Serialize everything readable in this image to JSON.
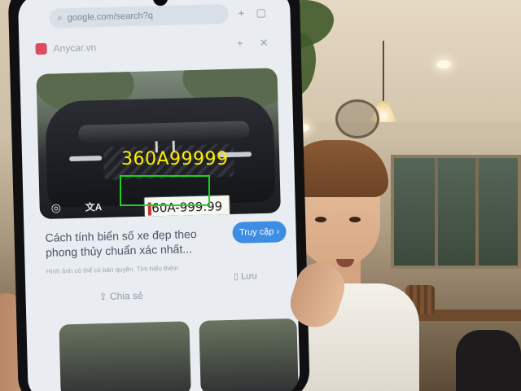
{
  "detection": {
    "label": "360A99999",
    "label_color": "#ffee00",
    "box_color": "#1fd11f"
  },
  "browser": {
    "url": "google.com/search?q",
    "tab_title": "Anycar.vn",
    "icons": [
      "home-icon",
      "plus-icon",
      "tab-switcher-icon",
      "menu-icon"
    ]
  },
  "result": {
    "plate": "60A-999.99",
    "title": "Cách tính biển số xe đẹp theo phong thủy chuẩn xác nhất...",
    "meta": "Hình ảnh có thể có bản quyền. Tìm hiểu thêm",
    "visit_label": "Truy cập",
    "share_label": "Chia sẻ",
    "save_label": "Lưu"
  }
}
